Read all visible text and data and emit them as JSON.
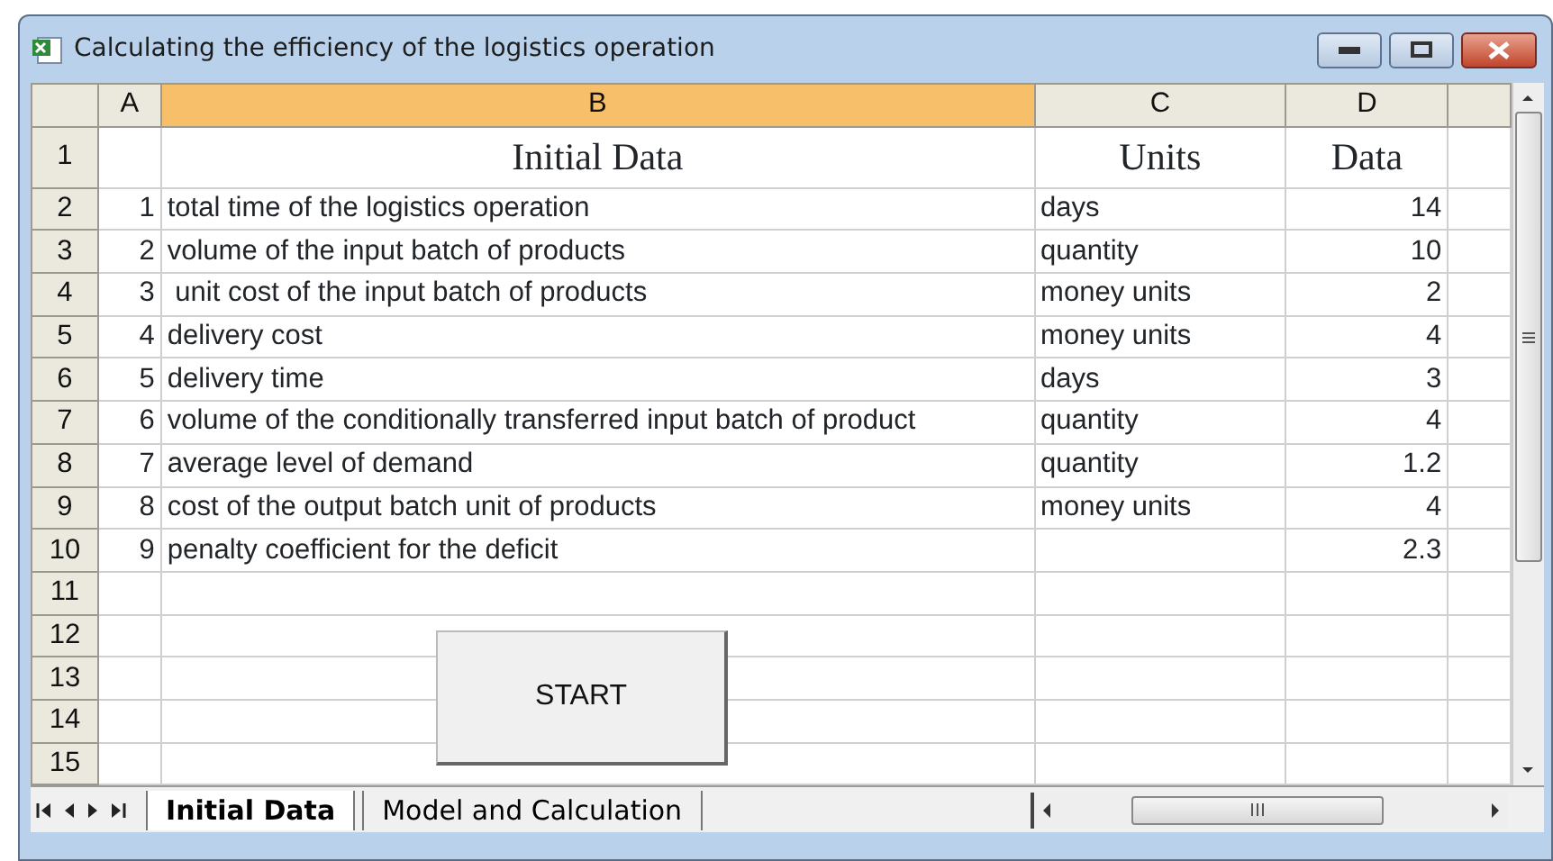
{
  "window": {
    "title": "Calculating the efficiency of the logistics operation"
  },
  "columns": [
    {
      "label": "A",
      "selected": false
    },
    {
      "label": "B",
      "selected": true
    },
    {
      "label": "C",
      "selected": false
    },
    {
      "label": "D",
      "selected": false
    }
  ],
  "rows": [
    {
      "header": "1",
      "kind": "heading",
      "col_b": "Initial Data",
      "col_c": "Units",
      "col_d": "Data"
    },
    {
      "header": "2",
      "kind": "data",
      "col_a": "1",
      "col_b": "total time of the logistics operation",
      "col_c": "days",
      "col_d": "14"
    },
    {
      "header": "3",
      "kind": "data",
      "col_a": "2",
      "col_b": "volume of the input batch of products",
      "col_c": "quantity",
      "col_d": "10"
    },
    {
      "header": "4",
      "kind": "data",
      "col_a": "3",
      "col_b": " unit cost of the input batch of products",
      "col_c": "money units",
      "col_d": "2"
    },
    {
      "header": "5",
      "kind": "data",
      "col_a": "4",
      "col_b": "delivery cost",
      "col_c": "money units",
      "col_d": "4"
    },
    {
      "header": "6",
      "kind": "data",
      "col_a": "5",
      "col_b": "delivery time",
      "col_c": "days",
      "col_d": "3"
    },
    {
      "header": "7",
      "kind": "data",
      "col_a": "6",
      "col_b": "volume of the conditionally transferred input batch of product",
      "col_c": "quantity",
      "col_d": "4"
    },
    {
      "header": "8",
      "kind": "data",
      "col_a": "7",
      "col_b": "average level of demand",
      "col_c": "quantity",
      "col_d": "1.2"
    },
    {
      "header": "9",
      "kind": "data",
      "col_a": "8",
      "col_b": "cost of the output batch unit of products",
      "col_c": "money units",
      "col_d": "4"
    },
    {
      "header": "10",
      "kind": "data",
      "col_a": "9",
      "col_b": "penalty coefficient for the deficit",
      "col_d": "2.3"
    },
    {
      "header": "11",
      "kind": "data"
    },
    {
      "header": "12",
      "kind": "data"
    },
    {
      "header": "13",
      "kind": "data"
    },
    {
      "header": "14",
      "kind": "data"
    },
    {
      "header": "15",
      "kind": "data"
    }
  ],
  "button": {
    "label": "START"
  },
  "sheet_tabs": [
    {
      "label": "Initial Data",
      "selected": true
    },
    {
      "label": "Model and Calculation",
      "selected": false
    }
  ]
}
